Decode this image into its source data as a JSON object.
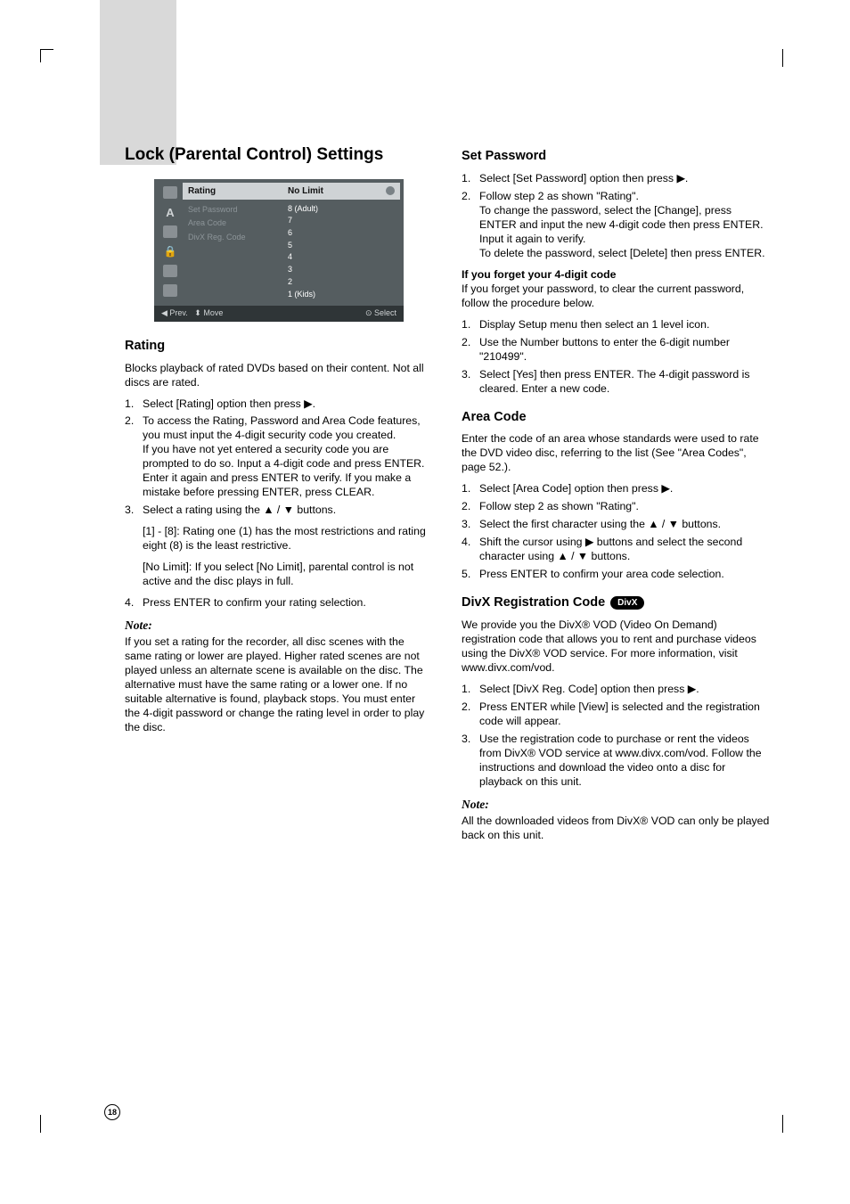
{
  "page_number": "18",
  "title": "Lock (Parental Control) Settings",
  "ui": {
    "menu_header": "Rating",
    "menu_items": [
      "Set Password",
      "Area Code",
      "DivX Reg. Code"
    ],
    "value_header": "No Limit",
    "values": [
      "8  (Adult)",
      "7",
      "6",
      "5",
      "4",
      "3",
      "2",
      "1  (Kids)"
    ],
    "footer_prev": "◀ Prev.",
    "footer_move": "⬍ Move",
    "footer_select": "⊙ Select"
  },
  "left": {
    "h_rating": "Rating",
    "rating_intro": "Blocks playback of rated DVDs based on their content. Not all discs are rated.",
    "rating_steps": [
      "Select [Rating] option then press ▶.",
      "To access the Rating, Password and Area Code features, you must input the 4-digit security code you created.\nIf you have not yet entered a security code you are prompted to do so. Input a 4-digit code and press ENTER. Enter it again and press ENTER to verify. If you make a mistake before pressing ENTER, press CLEAR.",
      "Select a rating using the ▲ / ▼ buttons.",
      "Press ENTER to confirm your rating selection."
    ],
    "rating_sub1": "[1] - [8]: Rating one (1) has the most restrictions and rating eight (8) is the least restrictive.",
    "rating_sub2": "[No Limit]: If you select [No Limit], parental control is not active and the disc plays in full.",
    "note_label": "Note:",
    "note_body": "If you set a rating for the recorder, all disc scenes with the same rating or lower are played. Higher rated scenes are not played unless an alternate scene is available on the disc. The alternative must have the same rating or a lower one. If no suitable alternative is found, playback stops. You must enter the 4-digit password or change the rating level in order to play the disc."
  },
  "right": {
    "h_setpw": "Set Password",
    "setpw_steps": [
      "Select [Set Password] option then press ▶.",
      "Follow step 2 as shown \"Rating\".\nTo change the password, select the [Change], press ENTER and input the new 4-digit code then press ENTER. Input it again to verify.\nTo delete the password, select [Delete] then press ENTER."
    ],
    "forgot_h": "If you forget your 4-digit code",
    "forgot_intro": "If you forget your password, to clear the current password, follow the procedure below.",
    "forgot_steps": [
      "Display Setup menu then select an 1 level icon.",
      "Use the Number buttons to enter the 6-digit number \"210499\".",
      "Select [Yes] then press ENTER. The 4-digit password is cleared. Enter a new code."
    ],
    "h_area": "Area Code",
    "area_intro": "Enter the code of an area whose standards were used to rate the DVD video disc, referring to the list (See \"Area Codes\", page 52.).",
    "area_steps": [
      "Select [Area Code] option then press ▶.",
      "Follow step 2 as shown \"Rating\".",
      "Select the first character using the ▲ / ▼ buttons.",
      "Shift the cursor using ▶ buttons and select the second character using ▲ / ▼ buttons.",
      "Press ENTER to confirm your area code selection."
    ],
    "h_divx": "DivX Registration Code",
    "divx_badge": "DivX",
    "divx_intro": "We provide you the DivX® VOD (Video On Demand) registration code that allows you to rent and purchase videos using the DivX® VOD service. For more information, visit www.divx.com/vod.",
    "divx_steps": [
      "Select [DivX Reg. Code] option then press ▶.",
      "Press ENTER while [View] is selected and the registration code will appear.",
      "Use the registration code to purchase or rent the videos from DivX® VOD service at www.divx.com/vod. Follow the instructions and download the video onto a disc for playback on this unit."
    ],
    "note_label": "Note:",
    "note_body": "All the downloaded videos from DivX® VOD can only be played back on this unit."
  }
}
